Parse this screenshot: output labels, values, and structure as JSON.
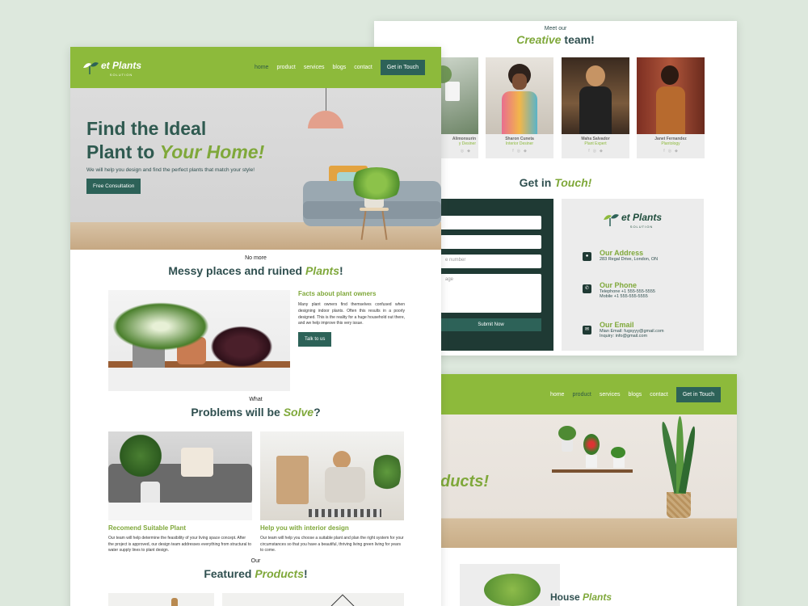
{
  "brand": {
    "name": "et Plants",
    "tagline": "SOLUTION",
    "accent": "#8dba3b",
    "dark": "#2d6258",
    "highlight": "#7fa83a"
  },
  "nav": {
    "items": [
      {
        "label": "home",
        "active": true
      },
      {
        "label": "product"
      },
      {
        "label": "services"
      },
      {
        "label": "blogs"
      },
      {
        "label": "contact"
      }
    ],
    "cta": "Get in Touch"
  },
  "nav2": {
    "items": [
      {
        "label": "home"
      },
      {
        "label": "product",
        "active": true
      },
      {
        "label": "services"
      },
      {
        "label": "blogs"
      },
      {
        "label": "contact"
      }
    ],
    "cta": "Get in Touch"
  },
  "hero": {
    "title_line1": "Find the Ideal",
    "title_line2_plain": "Plant to ",
    "title_line2_accent": "Your Home!",
    "subtitle": "We will help you design and find the perfect plants that match your style!",
    "cta": "Free Consultation"
  },
  "messy": {
    "kicker": "No more",
    "title_plain": "Messy places and ruined ",
    "title_accent": "Plants",
    "title_end": "!",
    "facts_title": "Facts about plant owners",
    "facts_body": "Many plant owners find themselves confused when designing indoor plants. Often this results in a poorly designed. This is the reality for a huge household out there, and we help improve this very issue.",
    "cta": "Talk to us"
  },
  "problems": {
    "kicker": "What",
    "title_plain": "Problems will be ",
    "title_accent": "Solve",
    "title_end": "?",
    "items": [
      {
        "title": "Recomend Suitable Plant",
        "body": "Our team will help determine the feasibility of your living space concept. After the project is approved, our design team addresses everything from structural to water supply lines to plant design."
      },
      {
        "title": "Help you with interior design",
        "body": "Our team will help you choose a suitable plant and plan the right system for your circumstances so that you have a beautiful, thriving living green living for years to come."
      }
    ]
  },
  "featured": {
    "kicker": "Our",
    "title_plain": "Featured ",
    "title_accent": "Products",
    "title_end": "!"
  },
  "team": {
    "kicker": "Meet our",
    "title_accent": "Creative",
    "title_plain": " team!",
    "members": [
      {
        "name": "Alimonsurin",
        "role": "y Desiner"
      },
      {
        "name": "Sharon Cuneta",
        "role": "Interior Desiner"
      },
      {
        "name": "Maha Salvador",
        "role": "Plant Expert"
      },
      {
        "name": "Janet Fernandez",
        "role": "Plantology"
      }
    ],
    "social_icons": [
      "facebook-icon",
      "instagram-icon",
      "twitter-icon"
    ]
  },
  "contact": {
    "title_plain": "Get in ",
    "title_accent": "Touch!",
    "form": {
      "phone_placeholder": "e number",
      "message_placeholder": "age",
      "submit": "Submit Now"
    },
    "info": [
      {
        "label": "Our Address",
        "lines": [
          "283 Regal Drive, London, ON"
        ],
        "icon": "location-pin-icon"
      },
      {
        "label": "Our Phone",
        "lines": [
          "Telephone +1 555-555-5555",
          "Mobile +1 555-555-5555"
        ],
        "icon": "phone-icon"
      },
      {
        "label": "Our Email",
        "lines": [
          "Mian Email: fugsyyy@gmail.com",
          "Inquiry: info@gmail.com"
        ],
        "icon": "envelope-icon"
      }
    ]
  },
  "products_page": {
    "hero_accent": "ducts!",
    "section_plain": "House ",
    "section_accent": "Plants"
  }
}
